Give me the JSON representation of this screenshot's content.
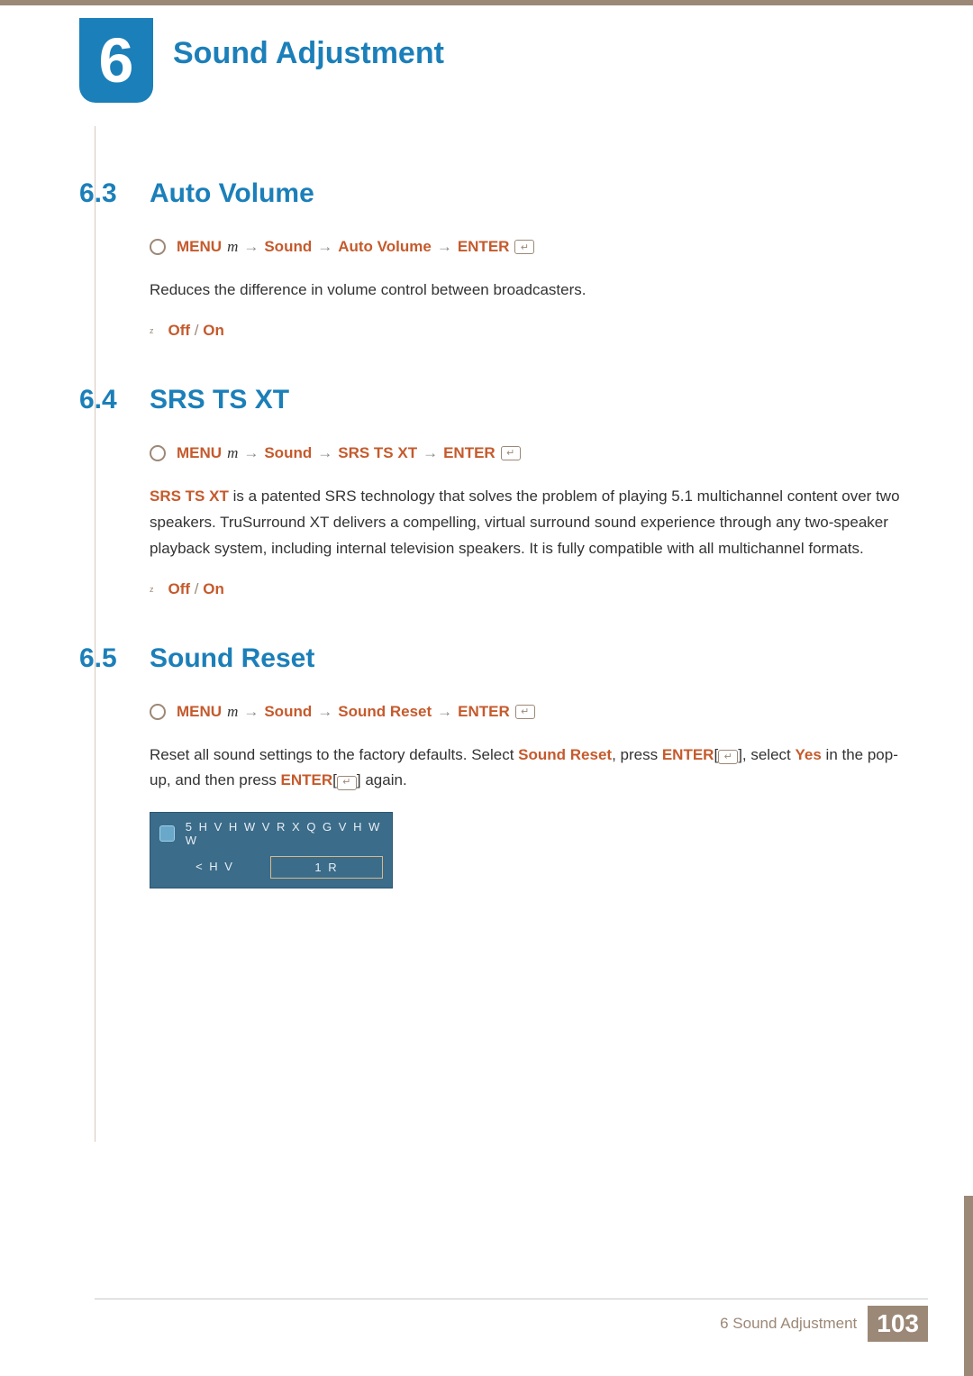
{
  "chapter": {
    "number": "6",
    "title": "Sound Adjustment"
  },
  "sections": [
    {
      "id": "auto-volume",
      "number": "6.3",
      "title": "Auto Volume",
      "nav": {
        "menu_label": "MENU",
        "m_glyph": "m",
        "items": [
          "Sound",
          "Auto Volume"
        ],
        "enter_label": "ENTER"
      },
      "body_plain": "Reduces the difference in volume control between broadcasters.",
      "options": {
        "off": "Off",
        "on": "On"
      }
    },
    {
      "id": "srs-ts-xt",
      "number": "6.4",
      "title": "SRS TS XT",
      "nav": {
        "menu_label": "MENU",
        "m_glyph": "m",
        "items": [
          "Sound",
          "SRS TS XT"
        ],
        "enter_label": "ENTER"
      },
      "body_rich": {
        "lead_bold": "SRS TS XT",
        "rest": " is a patented SRS technology that solves the problem of playing 5.1 multichannel content over two speakers. TruSurround XT delivers a compelling, virtual surround sound experience through any two-speaker playback system, including internal television speakers. It is fully compatible with all multichannel formats."
      },
      "options": {
        "off": "Off",
        "on": "On"
      }
    },
    {
      "id": "sound-reset",
      "number": "6.5",
      "title": "Sound Reset",
      "nav": {
        "menu_label": "MENU",
        "m_glyph": "m",
        "items": [
          "Sound",
          "Sound Reset"
        ],
        "enter_label": "ENTER"
      },
      "reset_paragraph": {
        "p1": "Reset all sound settings to the factory defaults. Select ",
        "sound_reset": "Sound Reset",
        "p2": ", press ",
        "enter1": "ENTER",
        "p3": "[",
        "p3b": "], select ",
        "yes": "Yes",
        "p4": " in the pop-up, and then press ",
        "enter2": "ENTER",
        "p5": "[",
        "p5b": "] again."
      },
      "dialog": {
        "title_glyphs": "5 H V H W   V R X Q G   V H W W",
        "btn_left": "< H V",
        "btn_right": "1 R"
      }
    }
  ],
  "footer": {
    "label": "6 Sound Adjustment",
    "page": "103"
  },
  "glyphs": {
    "arrow": "→",
    "enter_symbol": "↵",
    "slash": "/",
    "bullet": "z"
  }
}
